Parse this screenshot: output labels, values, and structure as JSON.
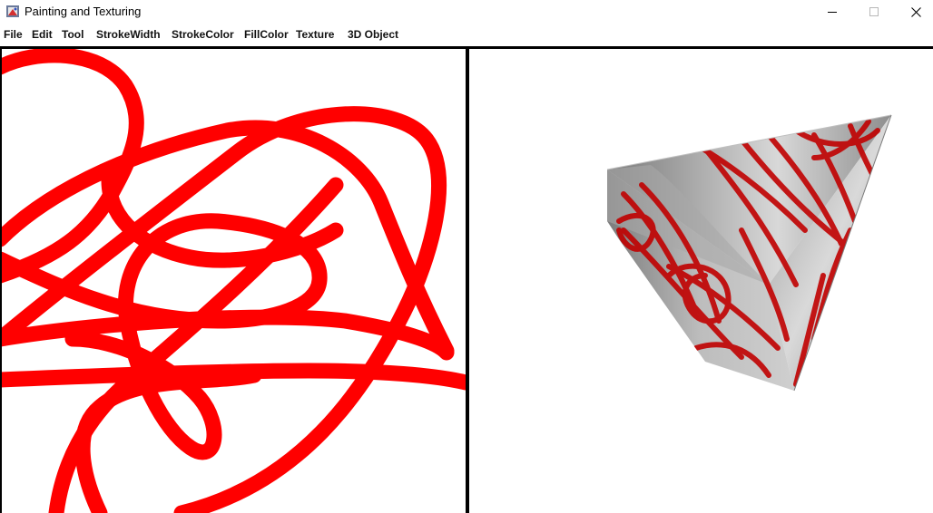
{
  "window": {
    "title": "Painting and Texturing",
    "controls": [
      "minimize-icon",
      "maximize-icon",
      "close-icon"
    ]
  },
  "menu": [
    {
      "label": "File"
    },
    {
      "label": "Edit"
    },
    {
      "label": "Tool"
    },
    {
      "label": "StrokeWidth"
    },
    {
      "label": "StrokeColor"
    },
    {
      "label": "FillColor"
    },
    {
      "label": "Texture"
    },
    {
      "label": "3D Object"
    }
  ],
  "canvas": {
    "stroke_color": "#ff0000",
    "background": "#ffffff"
  },
  "viewer": {
    "object": "cone",
    "texture_color": "#cc0000",
    "surface_color": "#a0a0a0"
  }
}
